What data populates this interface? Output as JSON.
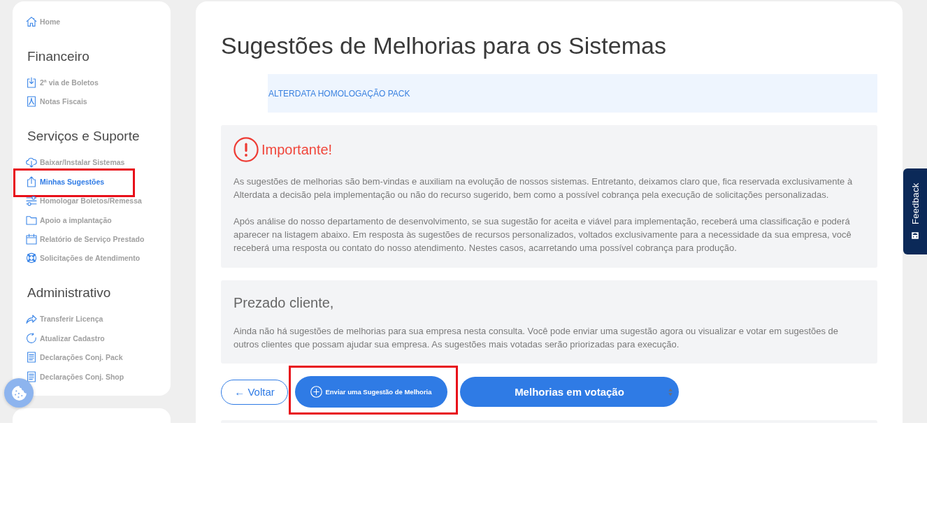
{
  "sidebar": {
    "sections": [
      {
        "items": [
          {
            "label": "Home",
            "selected": false,
            "highlighted": false
          }
        ]
      },
      {
        "title": "Financeiro",
        "items": [
          {
            "label": "2ª via de Boletos",
            "selected": false,
            "highlighted": false
          },
          {
            "label": "Notas Fiscais",
            "selected": false,
            "highlighted": false
          }
        ]
      },
      {
        "title": "Serviços e Suporte",
        "items": [
          {
            "label": "Baixar/Instalar Sistemas",
            "selected": false,
            "highlighted": false
          },
          {
            "label": "Minhas Sugestões",
            "selected": true,
            "highlighted": true
          },
          {
            "label": "Homologar Boletos/Remessa",
            "selected": false,
            "highlighted": false
          },
          {
            "label": "Apoio a implantação",
            "selected": false,
            "highlighted": false
          },
          {
            "label": "Relatório de Serviço Prestado",
            "selected": false,
            "highlighted": false
          },
          {
            "label": "Solicitações de Atendimento",
            "selected": false,
            "highlighted": false
          }
        ]
      },
      {
        "title": "Administrativo",
        "items": [
          {
            "label": "Transferir Licença",
            "selected": false,
            "highlighted": false
          },
          {
            "label": "Atualizar Cadastro",
            "selected": false,
            "highlighted": false
          },
          {
            "label": "Declarações Conj. Pack",
            "selected": false,
            "highlighted": false
          },
          {
            "label": "Declarações Conj. Shop",
            "selected": false,
            "highlighted": false
          }
        ]
      }
    ]
  },
  "page_title": "Sugestões de Melhorias para os Sistemas",
  "company_banner": "ALTERDATA HOMOLOGAÇÃO PACK",
  "notice": {
    "title": "Importante!",
    "paragraphs": [
      "As sugestões de melhorias são bem-vindas e auxiliam na evolução de nossos sistemas. Entretanto, deixamos claro que, fica reservada exclusivamente à Alterdata a decisão pela implementação ou não do recurso sugerido, bem como a possível cobrança pela execução de solicitações personalizadas.",
      "Após análise do nosso departamento de desenvolvimento, se sua sugestão for aceita e viável para implementação, receberá uma classificação e poderá aparecer na listagem abaixo. Em resposta às sugestões de recursos personalizados, voltados exclusivamente para a necessidade da sua empresa, você receberá uma resposta ou contato do nosso atendimento. Nestes casos, acarretando uma possível cobrança para produção."
    ]
  },
  "message": {
    "title": "Prezado cliente,",
    "paragraphs": [
      "Ainda não há sugestões de melhorias para sua empresa nesta consulta. Você pode enviar uma sugestão agora ou visualizar e votar em sugestões de outros clientes que possam ajudar sua empresa. As sugestões mais votadas serão priorizadas para execução."
    ]
  },
  "actions": [
    {
      "kind": "outline",
      "label": "← Voltar",
      "highlighted": false
    },
    {
      "kind": "primary",
      "label": "Enviar uma Sugestão de Melhoria",
      "highlighted": true
    },
    {
      "kind": "select",
      "label": "Melhorias em votação",
      "highlighted": false
    }
  ],
  "feedback_tab": {
    "label": "Feedback"
  }
}
